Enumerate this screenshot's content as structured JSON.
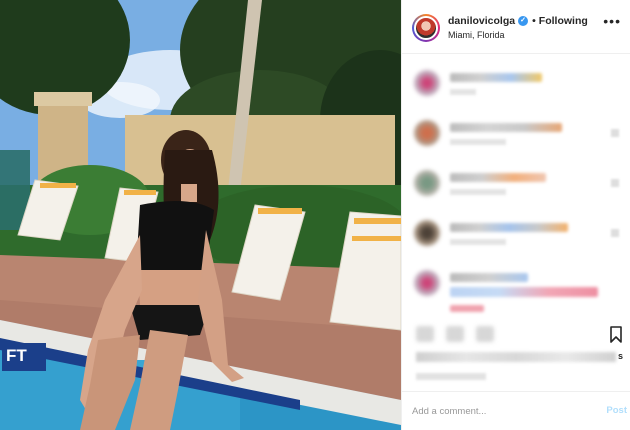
{
  "post": {
    "username": "danilovicolga",
    "verified_mark": "✓",
    "separator": "•",
    "follow_status": "Following",
    "location": "Miami, Florida",
    "more_label": "•••",
    "pool_sign_text": "FT"
  },
  "comment_box": {
    "placeholder": "Add a comment...",
    "post_label": "Post"
  },
  "actions": {
    "likes_suffix": "s"
  },
  "icons": {
    "verified": "verified-badge-icon",
    "more": "more-options-icon",
    "bookmark": "bookmark-icon"
  },
  "colors": {
    "link_blue": "#3897f0",
    "post_disabled": "#b2dffc",
    "border": "#efefef"
  }
}
